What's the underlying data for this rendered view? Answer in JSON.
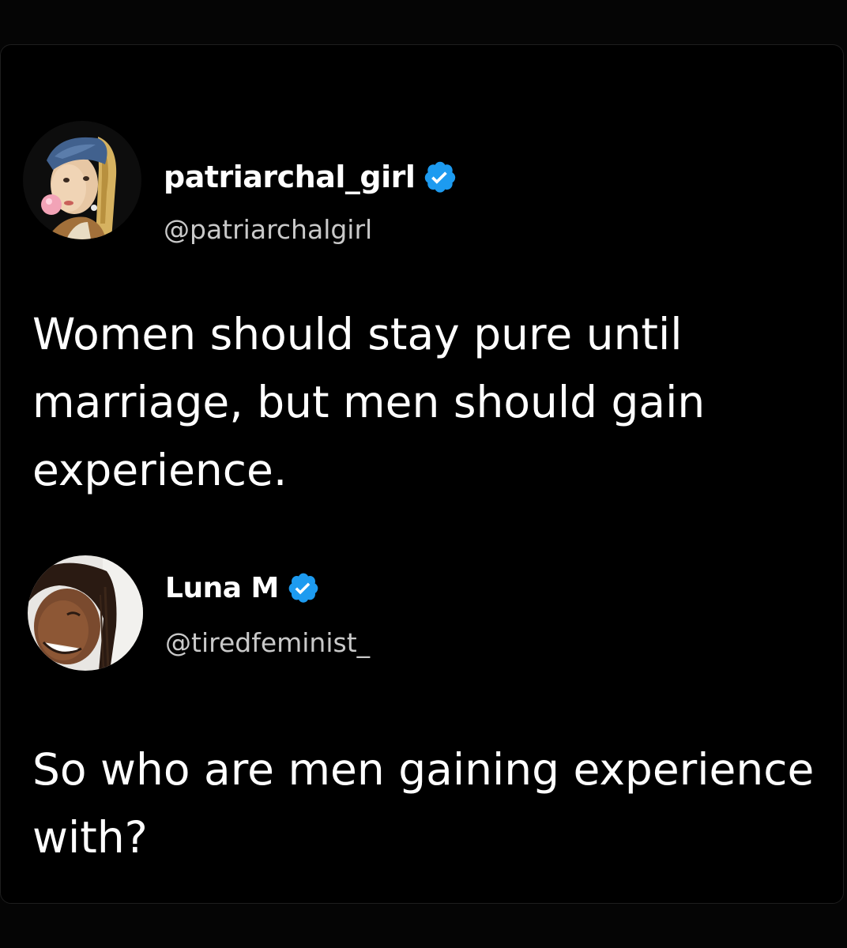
{
  "colors": {
    "background": "#000000",
    "text_primary": "#ffffff",
    "text_secondary": "#c9c9c9",
    "verified_badge": "#1d9bf0"
  },
  "posts": [
    {
      "display_name": "patriarchal_girl",
      "handle": "@patriarchalgirl",
      "verified": true,
      "avatar_icon": "painting-girl-pearl-earring-bubblegum",
      "text": "Women should stay pure until marriage, but men should gain experience."
    },
    {
      "display_name": "Luna M",
      "handle": "@tiredfeminist_",
      "verified": true,
      "avatar_icon": "smiling-woman-photo",
      "text": "So who are men gaining experience with?"
    }
  ]
}
